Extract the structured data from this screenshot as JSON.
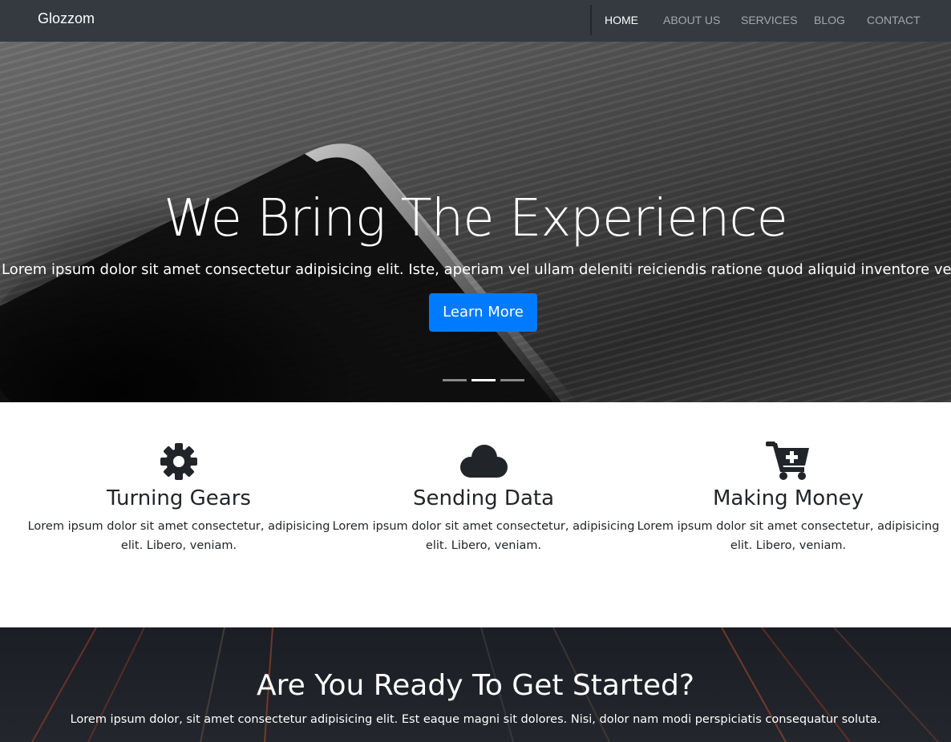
{
  "nav": {
    "brand": "Glozzom",
    "items": [
      {
        "label": "HOME",
        "active": true
      },
      {
        "label": "ABOUT US",
        "active": false
      },
      {
        "label": "SERVICES",
        "active": false
      },
      {
        "label": "BLOG",
        "active": false
      },
      {
        "label": "CONTACT",
        "active": false
      }
    ]
  },
  "hero": {
    "title": "We Bring The Experience",
    "text": "Lorem ipsum dolor sit amet consectetur adipisicing elit. Iste, aperiam vel ullam deleniti reiciendis ratione quod aliquid inventore vero perspiciatis.",
    "button_label": "Learn More",
    "button_color": "#007bff",
    "carousel": {
      "slides": 3,
      "active_index": 1
    }
  },
  "features": [
    {
      "icon": "gear-icon",
      "title": "Turning Gears",
      "text": "Lorem ipsum dolor sit amet consectetur, adipisicing elit. Libero, veniam."
    },
    {
      "icon": "cloud-icon",
      "title": "Sending Data",
      "text": "Lorem ipsum dolor sit amet consectetur, adipisicing elit. Libero, veniam."
    },
    {
      "icon": "cart-plus-icon",
      "title": "Making Money",
      "text": "Lorem ipsum dolor sit amet consectetur, adipisicing elit. Libero, veniam."
    }
  ],
  "cta": {
    "title": "Are You Ready To Get Started?",
    "text": "Lorem ipsum dolor, sit amet consectetur adipisicing elit. Est eaque magni sit dolores. Nisi, dolor nam modi perspiciatis consequatur soluta."
  },
  "colors": {
    "navbar": "#343a40",
    "primary": "#007bff",
    "text": "#212529"
  }
}
